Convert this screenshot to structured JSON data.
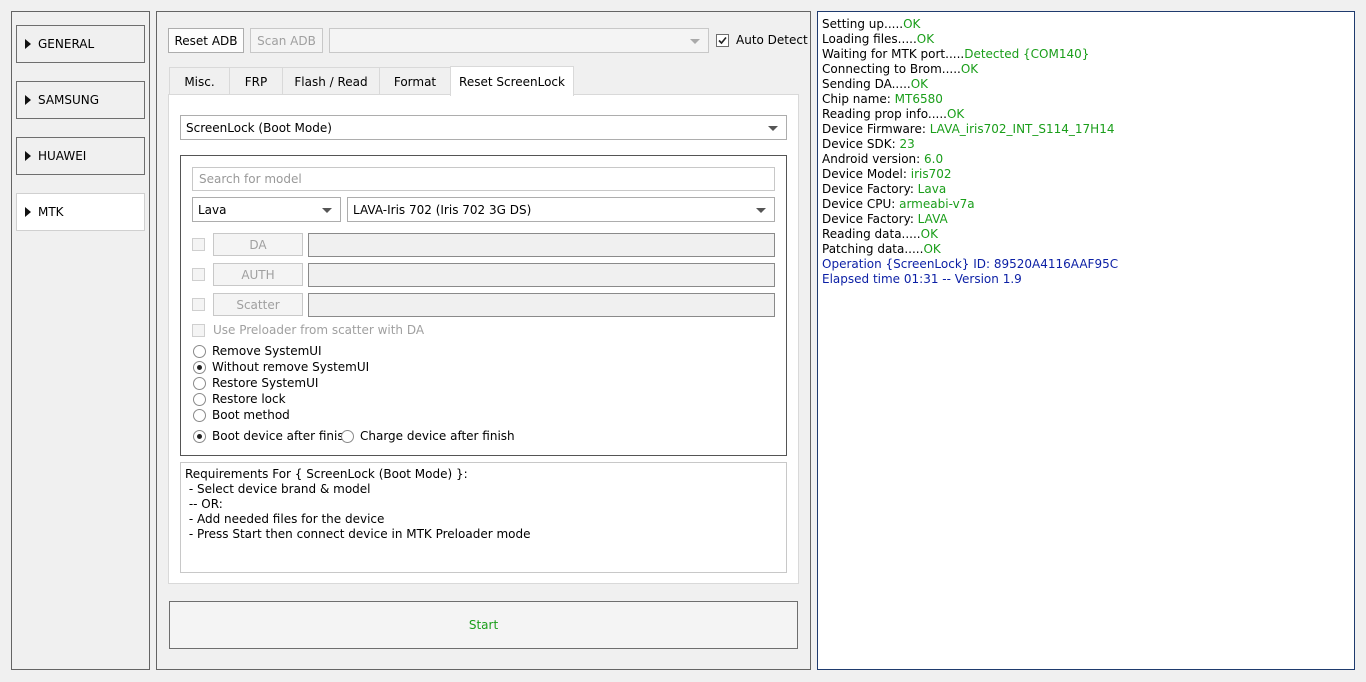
{
  "sidebar": {
    "items": [
      {
        "label": "GENERAL"
      },
      {
        "label": "SAMSUNG"
      },
      {
        "label": "HUAWEI"
      },
      {
        "label": "MTK"
      }
    ]
  },
  "toolbar": {
    "reset_adb": "Reset ADB",
    "scan_adb": "Scan ADB",
    "port_value": "",
    "auto_detect": "Auto Detect"
  },
  "tabs": [
    {
      "label": "Misc."
    },
    {
      "label": "FRP"
    },
    {
      "label": "Flash / Read"
    },
    {
      "label": "Format"
    },
    {
      "label": "Reset ScreenLock"
    }
  ],
  "screenlock": {
    "mode_select": "ScreenLock (Boot Mode)",
    "search_placeholder": "Search for model",
    "brand_select": "Lava",
    "model_select": "LAVA-Iris 702 (Iris 702 3G DS)",
    "file_buttons": [
      "DA",
      "AUTH",
      "Scatter"
    ],
    "use_preloader": "Use Preloader from scatter with DA",
    "options": [
      {
        "label": "Remove SystemUI",
        "checked": false
      },
      {
        "label": "Without remove SystemUI",
        "checked": true
      },
      {
        "label": "Restore SystemUI",
        "checked": false
      },
      {
        "label": "Restore lock",
        "checked": false
      },
      {
        "label": "Boot method",
        "checked": false
      }
    ],
    "after_finish": [
      {
        "label": "Boot device after finish",
        "checked": true
      },
      {
        "label": "Charge device after finish",
        "checked": false
      }
    ]
  },
  "requirements": [
    "Requirements For { ScreenLock (Boot Mode) }:",
    " - Select device brand & model",
    " -- OR:",
    " - Add needed files for the device",
    " - Press Start then connect device in MTK Preloader mode"
  ],
  "start_label": "Start",
  "log": [
    {
      "text": "Setting up.....",
      "value": "OK"
    },
    {
      "text": "Loading files.....",
      "value": "OK"
    },
    {
      "text": "Waiting for MTK port.....",
      "value": "Detected {COM140}"
    },
    {
      "text": "Connecting to Brom.....",
      "value": "OK"
    },
    {
      "text": "Sending DA.....",
      "value": "OK"
    },
    {
      "text": "Chip name: ",
      "value": "MT6580"
    },
    {
      "text": "Reading prop info.....",
      "value": "OK"
    },
    {
      "text": "Device Firmware: ",
      "value": "LAVA_iris702_INT_S114_17H14"
    },
    {
      "text": "Device SDK: ",
      "value": "23"
    },
    {
      "text": "Android version: ",
      "value": "6.0"
    },
    {
      "text": "Device Model: ",
      "value": "iris702"
    },
    {
      "text": "Device Factory: ",
      "value": "Lava"
    },
    {
      "text": "Device CPU: ",
      "value": "armeabi-v7a"
    },
    {
      "text": "Device Factory: ",
      "value": "LAVA"
    },
    {
      "text": "Reading data.....",
      "value": "OK"
    },
    {
      "text": "Patching data.....",
      "value": "OK"
    }
  ],
  "log_status": [
    "Operation {ScreenLock} ID: 89520A4116AAF95C",
    "Elapsed time 01:31 -- Version 1.9"
  ],
  "colors": {
    "ok": "#1a9e1a",
    "status": "#0b1fa5",
    "log_border": "#1f3b6e"
  }
}
